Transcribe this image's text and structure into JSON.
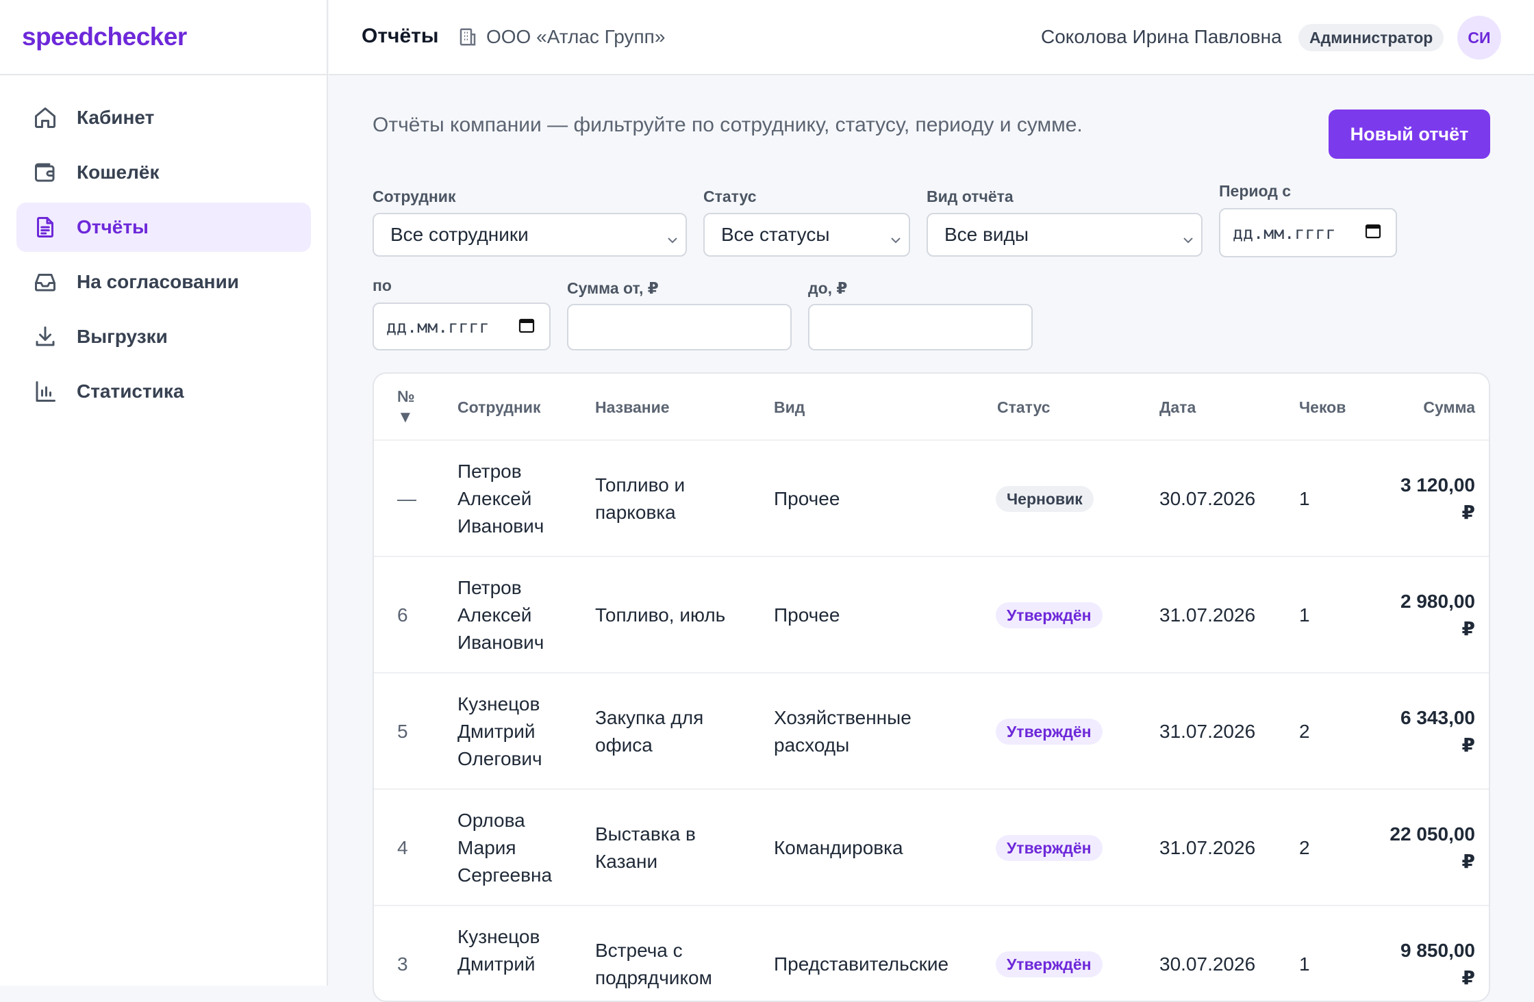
{
  "app": {
    "logo": "speedchecker"
  },
  "sidebar": {
    "items": [
      {
        "label": "Кабинет",
        "icon": "home-icon"
      },
      {
        "label": "Кошелёк",
        "icon": "wallet-icon"
      },
      {
        "label": "Отчёты",
        "icon": "document-icon",
        "active": true
      },
      {
        "label": "На согласовании",
        "icon": "inbox-icon"
      },
      {
        "label": "Выгрузки",
        "icon": "download-icon"
      },
      {
        "label": "Статистика",
        "icon": "bar-chart-icon"
      }
    ]
  },
  "header": {
    "title": "Отчёты",
    "company": "ООО «Атлас Групп»",
    "user": "Соколова Ирина Павловна",
    "role": "Администратор",
    "avatar": "СИ"
  },
  "main": {
    "intro": "Отчёты компании — фильтруйте по сотруднику, статусу, периоду и сумме.",
    "new_button": "Новый отчёт"
  },
  "filters": {
    "employee": {
      "label": "Сотрудник",
      "value": "Все сотрудники"
    },
    "status": {
      "label": "Статус",
      "value": "Все статусы"
    },
    "type": {
      "label": "Вид отчёта",
      "value": "Все виды"
    },
    "period_from": {
      "label": "Период с",
      "value": "дд.мм.гггг"
    },
    "period_to": {
      "label": "по",
      "value": "дд.мм.гггг"
    },
    "sum_from": {
      "label": "Сумма от, ₽",
      "value": ""
    },
    "sum_to": {
      "label": "до, ₽",
      "value": ""
    }
  },
  "table": {
    "headers": {
      "num": "№",
      "sort": "▼",
      "employee": "Сотрудник",
      "name": "Название",
      "type": "Вид",
      "status": "Статус",
      "date": "Дата",
      "checks": "Чеков",
      "sum": "Сумма"
    },
    "rows": [
      {
        "num": "—",
        "emp1": "Петров",
        "emp2": "Алексей",
        "emp3": "Иванович",
        "name1": "Топливо и",
        "name2": "парковка",
        "type1": "Прочее",
        "type2": "",
        "status": "Черновик",
        "date": "30.07.2026",
        "checks": "1",
        "sum": "3 120,00",
        "cur": "₽"
      },
      {
        "num": "6",
        "emp1": "Петров",
        "emp2": "Алексей",
        "emp3": "Иванович",
        "name1": "Топливо, июль",
        "name2": "",
        "type1": "Прочее",
        "type2": "",
        "status": "Утверждён",
        "date": "31.07.2026",
        "checks": "1",
        "sum": "2 980,00",
        "cur": "₽"
      },
      {
        "num": "5",
        "emp1": "Кузнецов",
        "emp2": "Дмитрий",
        "emp3": "Олегович",
        "name1": "Закупка для",
        "name2": "офиса",
        "type1": "Хозяйственные",
        "type2": "расходы",
        "status": "Утверждён",
        "date": "31.07.2026",
        "checks": "2",
        "sum": "6 343,00",
        "cur": "₽"
      },
      {
        "num": "4",
        "emp1": "Орлова",
        "emp2": "Мария",
        "emp3": "Сергеевна",
        "name1": "Выставка в",
        "name2": "Казани",
        "type1": "Командировка",
        "type2": "",
        "status": "Утверждён",
        "date": "31.07.2026",
        "checks": "2",
        "sum": "22 050,00",
        "cur": "₽"
      },
      {
        "num": "3",
        "emp1": "Кузнецов",
        "emp2": "Дмитрий",
        "emp3": "",
        "name1": "Встреча с",
        "name2": "подрядчиком",
        "type1": "Представительские",
        "type2": "",
        "status": "Утверждён",
        "date": "30.07.2026",
        "checks": "1",
        "sum": "9 850,00",
        "cur": "₽"
      }
    ]
  }
}
